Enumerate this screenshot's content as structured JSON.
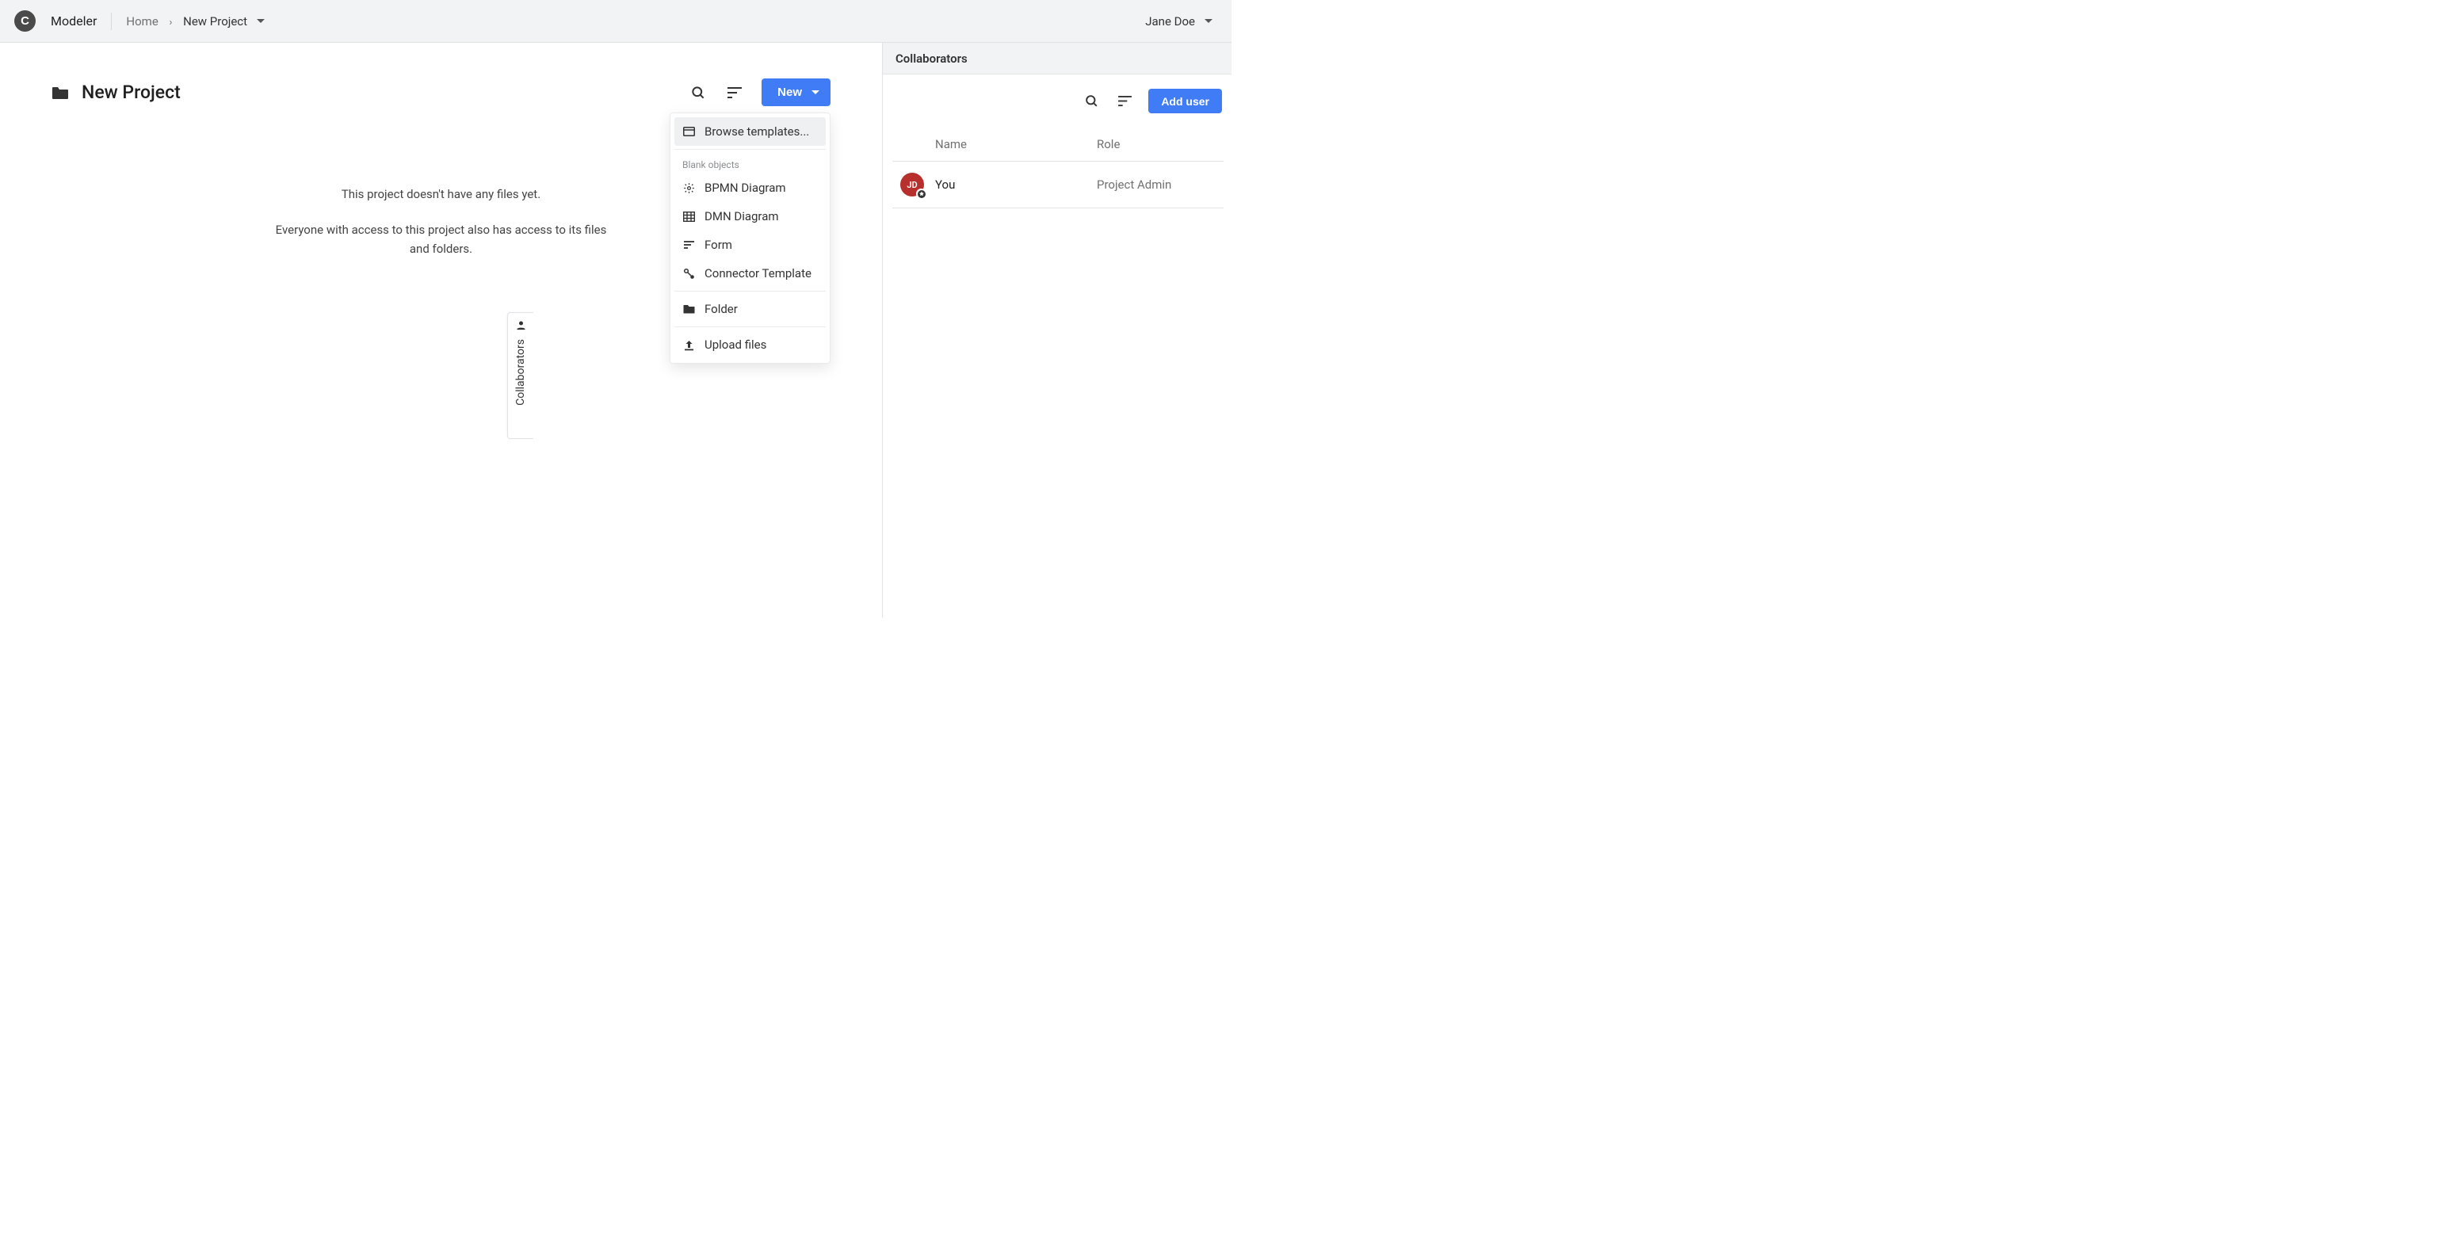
{
  "header": {
    "app_name": "Modeler",
    "breadcrumb": {
      "home": "Home",
      "current": "New Project"
    },
    "user_name": "Jane Doe"
  },
  "project": {
    "title": "New Project",
    "empty_line1": "This project doesn't have any files yet.",
    "empty_line2": "Everyone with access to this project also has access to its files and folders."
  },
  "toolbar": {
    "new_label": "New"
  },
  "dropdown": {
    "browse_templates": "Browse templates...",
    "section_label": "Blank objects",
    "bpmn": "BPMN Diagram",
    "dmn": "DMN Diagram",
    "form": "Form",
    "connector": "Connector Template",
    "folder": "Folder",
    "upload": "Upload files"
  },
  "side": {
    "title": "Collaborators",
    "add_user": "Add user",
    "columns": {
      "name": "Name",
      "role": "Role"
    },
    "rows": [
      {
        "initials": "JD",
        "name": "You",
        "role": "Project Admin"
      }
    ]
  },
  "tab_handle": {
    "label": "Collaborators"
  }
}
